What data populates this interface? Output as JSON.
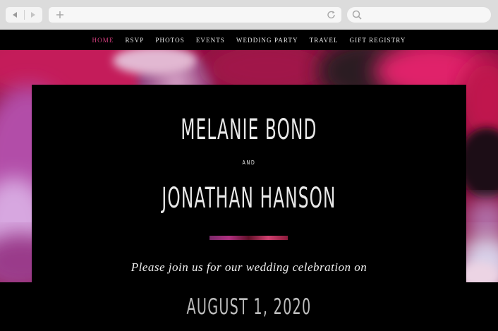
{
  "browser": {
    "back_icon": "back-arrow-icon",
    "forward_icon": "forward-arrow-icon",
    "new_tab_icon": "plus-icon",
    "reload_icon": "reload-icon",
    "search_icon": "search-icon"
  },
  "nav": {
    "items": [
      {
        "label": "HOME",
        "active": true
      },
      {
        "label": "RSVP"
      },
      {
        "label": "PHOTOS"
      },
      {
        "label": "EVENTS"
      },
      {
        "label": "WEDDING PARTY"
      },
      {
        "label": "TRAVEL"
      },
      {
        "label": "GIFT REGISTRY"
      }
    ],
    "active_color": "#d53f7f"
  },
  "hero": {
    "name1": "MELANIE BOND",
    "and": "AND",
    "name2": "JONATHAN HANSON",
    "invite": "Please join us for our wedding celebration on",
    "date": "AUGUST 1, 2020"
  },
  "colors": {
    "magenta": "#c41e5a",
    "purple": "#8a4fa8",
    "background": "#000000"
  }
}
